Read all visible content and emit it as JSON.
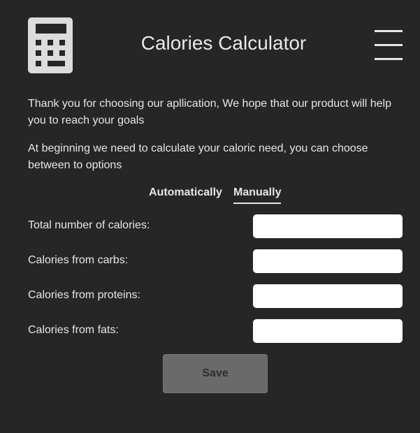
{
  "header": {
    "title": "Calories Calculator",
    "left_icon": "calculator-icon",
    "menu_icon": "hamburger-menu-icon"
  },
  "intro": {
    "paragraph_1": "Thank you for choosing our apllication, We hope that our product will help you to reach your goals",
    "paragraph_2": "At beginning we need to calculate your caloric need, you can choose between to options"
  },
  "mode_tabs": {
    "automatic_label": "Automatically",
    "manual_label": "Manually",
    "selected": "Manually"
  },
  "form": {
    "fields": [
      {
        "label": "Total number of calories:",
        "value": "",
        "placeholder": ""
      },
      {
        "label": "Calories from carbs:",
        "value": "",
        "placeholder": ""
      },
      {
        "label": "Calories from proteins:",
        "value": "",
        "placeholder": ""
      },
      {
        "label": "Calories from fats:",
        "value": "",
        "placeholder": ""
      }
    ],
    "save_label": "Save"
  },
  "colors": {
    "background": "#262626",
    "text": "#e6e6e6",
    "input_background": "#ffffff",
    "save_button_background": "#6a6a6a",
    "icon": "#dcdcdc"
  }
}
